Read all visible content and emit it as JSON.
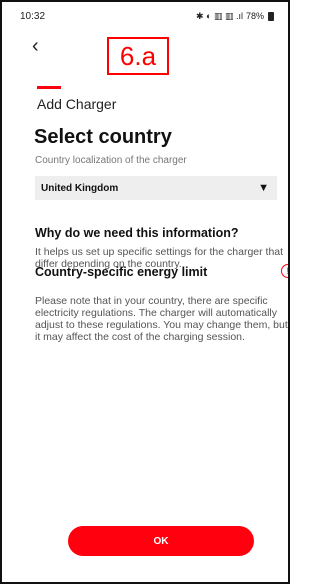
{
  "status_bar": {
    "time": "10:32",
    "indicators": "✱ ◐ ▥ ▥ .ıl",
    "battery_percent": "78%"
  },
  "step_badge": "6.a",
  "header": {
    "title": "Add Charger",
    "back_icon": "chevron-left-icon"
  },
  "country": {
    "heading": "Select country",
    "subtitle": "Country localization of the charger",
    "selected_value": "United Kingdom"
  },
  "why_section": {
    "title": "Why do we need this information?",
    "body": "It helps us set up specific settings for the charger that differ depending on the country."
  },
  "energy_section": {
    "title": "Country-specific energy limit",
    "icon": "!",
    "body": "Please note that in your country, there are specific electricity regulations. The charger will automatically adjust to these regulations. You may change them, but it may affect the cost of the charging session."
  },
  "ok_button": "OK",
  "colors": {
    "accent": "#ff000f",
    "badge_red": "#ff0000",
    "select_bg": "#eeeeee"
  }
}
